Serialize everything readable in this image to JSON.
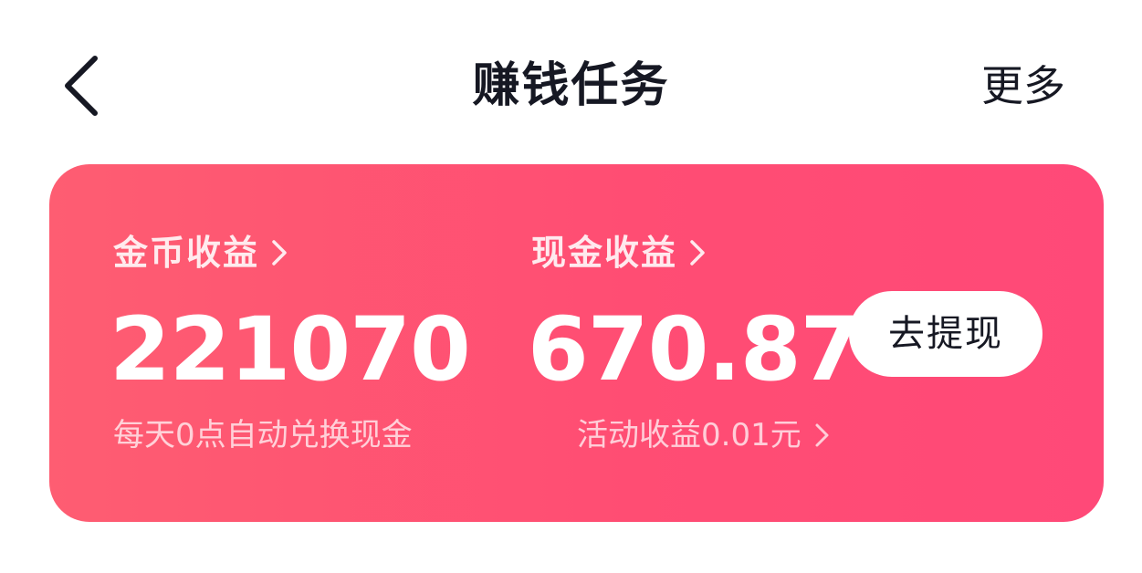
{
  "header": {
    "title": "赚钱任务",
    "more_label": "更多",
    "back_icon": "chevron-left-icon"
  },
  "card": {
    "gradient": [
      "#fe5d72",
      "#ff4978"
    ],
    "coin": {
      "label": "金币收益",
      "amount": "221070",
      "note": "每天0点自动兑换现金"
    },
    "cash": {
      "label": "现金收益",
      "amount": "670.87",
      "note": "活动收益0.01元"
    },
    "withdraw_label": "去提现"
  }
}
